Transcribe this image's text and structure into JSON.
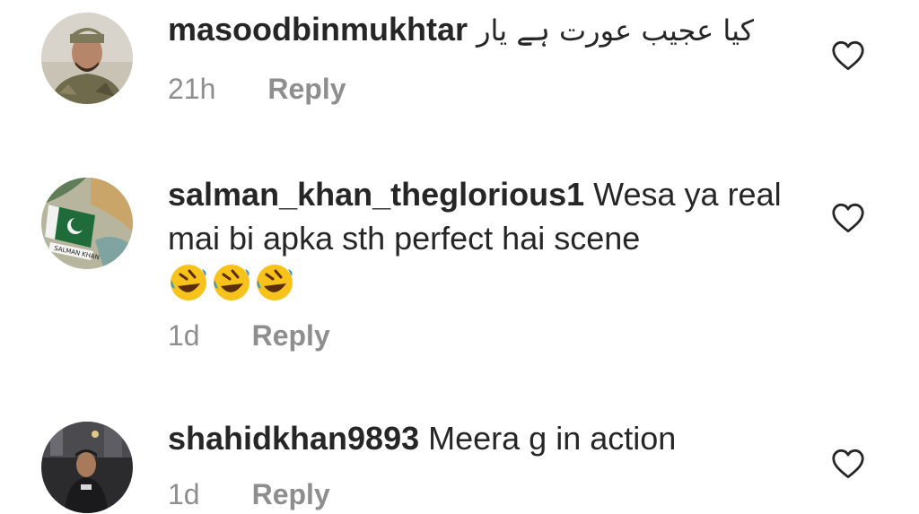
{
  "comments": [
    {
      "username": "masoodbinmukhtar",
      "text": "کیا عجیب عورت ہے یار",
      "time": "21h",
      "reply_label": "Reply",
      "avatar_icon": "person-photo"
    },
    {
      "username": "salman_khan_theglorious1",
      "text": "Wesa ya real mai bi apka sth perfect hai scene",
      "emojis": [
        "🤣",
        "🤣",
        "🤣"
      ],
      "time": "1d",
      "reply_label": "Reply",
      "avatar_icon": "pakistan-flag-hand"
    },
    {
      "username": "shahidkhan9893",
      "text": "Meera g in action",
      "time": "1d",
      "reply_label": "Reply",
      "avatar_icon": "person-photo"
    }
  ],
  "colors": {
    "text": "#262626",
    "muted": "#8e8e8e",
    "background": "#ffffff"
  },
  "icons": {
    "like": "heart-outline-icon"
  }
}
